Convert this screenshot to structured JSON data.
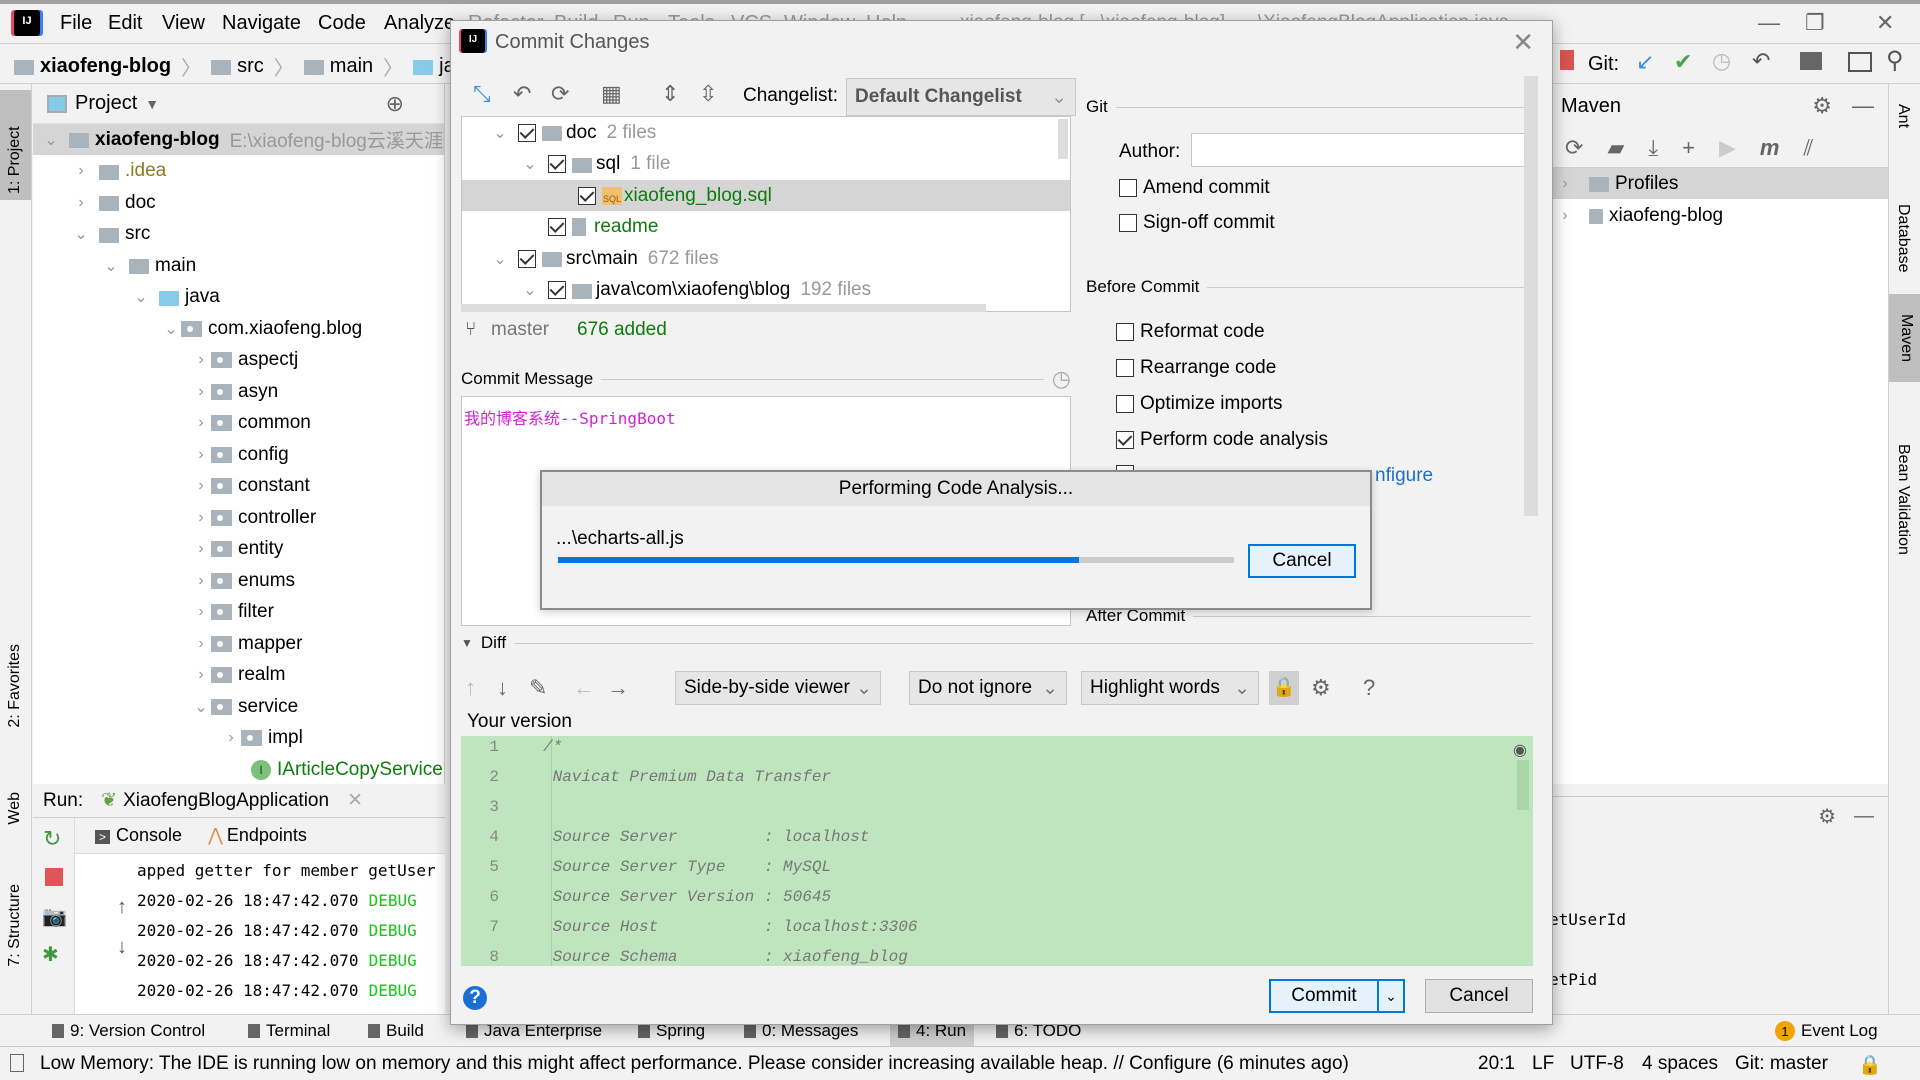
{
  "menubar": {
    "items": [
      "File",
      "Edit",
      "View",
      "Navigate",
      "Code",
      "Analyze",
      "Refactor",
      "Build",
      "Run",
      "Tools",
      "VCS",
      "Window",
      "Help"
    ],
    "window_title": "xiaofeng-blog [...\\xiaofeng-blog] - ...\\XiaofengBlogApplication.java"
  },
  "navbar": {
    "breadcrumbs": [
      "xiaofeng-blog",
      "src",
      "main",
      "java"
    ],
    "git_label": "Git:"
  },
  "left_tool_tabs": [
    "1: Project",
    "2: Favorites",
    "Web",
    "7: Structure"
  ],
  "right_tool_tabs": [
    "Ant",
    "Database",
    "Maven",
    "Bean Validation"
  ],
  "project_panel": {
    "title": "Project",
    "tree": [
      {
        "label": "xiaofeng-blog",
        "path": "E:\\xiaofeng-blog云溪天涯",
        "indent": 0,
        "expanded": true,
        "bold": true
      },
      {
        "label": ".idea",
        "indent": 1,
        "expanded": false
      },
      {
        "label": "doc",
        "indent": 1,
        "expanded": false
      },
      {
        "label": "src",
        "indent": 1,
        "expanded": true
      },
      {
        "label": "main",
        "indent": 2,
        "expanded": true
      },
      {
        "label": "java",
        "indent": 3,
        "expanded": true
      },
      {
        "label": "com.xiaofeng.blog",
        "indent": 4,
        "expanded": true
      },
      {
        "label": "aspectj",
        "indent": 5,
        "expanded": false
      },
      {
        "label": "asyn",
        "indent": 5,
        "expanded": false
      },
      {
        "label": "common",
        "indent": 5,
        "expanded": false
      },
      {
        "label": "config",
        "indent": 5,
        "expanded": false
      },
      {
        "label": "constant",
        "indent": 5,
        "expanded": false
      },
      {
        "label": "controller",
        "indent": 5,
        "expanded": false
      },
      {
        "label": "entity",
        "indent": 5,
        "expanded": false
      },
      {
        "label": "enums",
        "indent": 5,
        "expanded": false
      },
      {
        "label": "filter",
        "indent": 5,
        "expanded": false
      },
      {
        "label": "mapper",
        "indent": 5,
        "expanded": false
      },
      {
        "label": "realm",
        "indent": 5,
        "expanded": false
      },
      {
        "label": "service",
        "indent": 5,
        "expanded": true
      },
      {
        "label": "impl",
        "indent": 6,
        "expanded": false
      },
      {
        "label": "IArticleCopyService",
        "indent": 6,
        "interface": true
      }
    ]
  },
  "run_panel": {
    "label": "Run:",
    "config": "XiaofengBlogApplication",
    "tabs": [
      "Console",
      "Endpoints"
    ],
    "lines": [
      {
        "text": "apped getter for member getUser",
        "level": ""
      },
      {
        "text": "2020-02-26 18:47:42.070",
        "level": "DEBUG"
      },
      {
        "text": "2020-02-26 18:47:42.070",
        "level": "DEBUG"
      },
      {
        "text": "2020-02-26 18:47:42.070",
        "level": "DEBUG"
      },
      {
        "text": "2020-02-26 18:47:42.070",
        "level": "DEBUG"
      }
    ],
    "right_fragments": [
      "etUserId",
      "etPid"
    ]
  },
  "maven_panel": {
    "title": "Maven",
    "items": [
      "Profiles",
      "xiaofeng-blog"
    ]
  },
  "commit_dialog": {
    "title": "Commit Changes",
    "changelist_label": "Changelist:",
    "changelist_value": "Default Changelist",
    "changes": [
      {
        "name": "doc",
        "count": "2 files",
        "indent": 1,
        "expanded": true,
        "checked": true
      },
      {
        "name": "sql",
        "count": "1 file",
        "indent": 2,
        "expanded": true,
        "checked": true
      },
      {
        "name": "xiaofeng_blog.sql",
        "count": "",
        "indent": 3,
        "file": "sql",
        "checked": true,
        "selected": true
      },
      {
        "name": "readme",
        "count": "",
        "indent": 2,
        "file": "text",
        "checked": true
      },
      {
        "name": "src\\main",
        "count": "672 files",
        "indent": 1,
        "expanded": true,
        "checked": true
      },
      {
        "name": "java\\com\\xiaofeng\\blog",
        "count": "192 files",
        "indent": 2,
        "expanded": true,
        "checked": true
      }
    ],
    "branch": "master",
    "added_summary": "676 added",
    "commit_message_label": "Commit Message",
    "commit_message": "我的博客系统--SpringBoot",
    "git_section": "Git",
    "author_label": "Author:",
    "author_value": "",
    "git_options": [
      {
        "label": "Amend commit",
        "checked": false
      },
      {
        "label": "Sign-off commit",
        "checked": false
      }
    ],
    "before_commit_section": "Before Commit",
    "before_options": [
      {
        "label": "Reformat code",
        "checked": false
      },
      {
        "label": "Rearrange code",
        "checked": false
      },
      {
        "label": "Optimize imports",
        "checked": false
      },
      {
        "label": "Perform code analysis",
        "checked": true
      }
    ],
    "configure_link_fragment": "nfigure",
    "after_commit_section": "After Commit",
    "diff_label": "Diff",
    "diff_viewer": "Side-by-side viewer",
    "diff_ignore": "Do not ignore",
    "diff_highlight": "Highlight words",
    "your_version_label": "Your version",
    "diff_lines": [
      {
        "n": "1",
        "text": "/*"
      },
      {
        "n": "2",
        "text": " Navicat Premium Data Transfer"
      },
      {
        "n": "3",
        "text": ""
      },
      {
        "n": "4",
        "text": " Source Server         : localhost"
      },
      {
        "n": "5",
        "text": " Source Server Type    : MySQL"
      },
      {
        "n": "6",
        "text": " Source Server Version : 50645"
      },
      {
        "n": "7",
        "text": " Source Host           : localhost:3306"
      },
      {
        "n": "8",
        "text": " Source Schema         : xiaofeng_blog"
      }
    ],
    "commit_button": "Commit",
    "cancel_button": "Cancel",
    "help": "?"
  },
  "progress_dialog": {
    "title": "Performing Code Analysis...",
    "file": "...\\echarts-all.js",
    "progress": 0.77,
    "cancel_button": "Cancel",
    "colors": {
      "fill": "#0a74da",
      "track": "#cccccc"
    }
  },
  "bottom_tabs": [
    "9: Version Control",
    "Terminal",
    "Build",
    "Java Enterprise",
    "Spring",
    "0: Messages",
    "4: Run",
    "6: TODO"
  ],
  "event_log": {
    "count": "1",
    "label": "Event Log"
  },
  "statusbar": {
    "message": "Low Memory: The IDE is running low on memory and this might affect performance. Please consider increasing available heap. // Configure (6 minutes ago)",
    "position": "20:1",
    "line_sep": "LF",
    "encoding": "UTF-8",
    "indent": "4 spaces",
    "vcs": "Git: master"
  }
}
